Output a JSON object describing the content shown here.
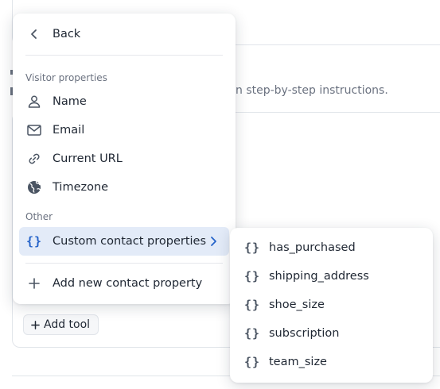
{
  "background": {
    "instructions_text": "n step-by-step instructions.",
    "add_tool_label": "Add tool"
  },
  "menu": {
    "back_label": "Back",
    "visitor_section_label": "Visitor properties",
    "visitor_items": [
      {
        "label": "Name",
        "icon": "person-icon"
      },
      {
        "label": "Email",
        "icon": "mail-icon"
      },
      {
        "label": "Current URL",
        "icon": "link-icon"
      },
      {
        "label": "Timezone",
        "icon": "globe-icon"
      }
    ],
    "other_section_label": "Other",
    "custom_properties_label": "Custom contact properties",
    "add_property_label": "Add new contact property"
  },
  "submenu": {
    "items": [
      {
        "label": "has_purchased",
        "icon": "braces-icon"
      },
      {
        "label": "shipping_address",
        "icon": "braces-icon"
      },
      {
        "label": "shoe_size",
        "icon": "braces-icon"
      },
      {
        "label": "subscription",
        "icon": "braces-icon"
      },
      {
        "label": "team_size",
        "icon": "braces-icon"
      }
    ]
  },
  "icon_glyphs": {
    "braces": "{}"
  },
  "colors": {
    "accent": "#2563c9",
    "active_bg": "#e3ebf8",
    "text": "#1f2733",
    "muted": "#6b7280"
  }
}
